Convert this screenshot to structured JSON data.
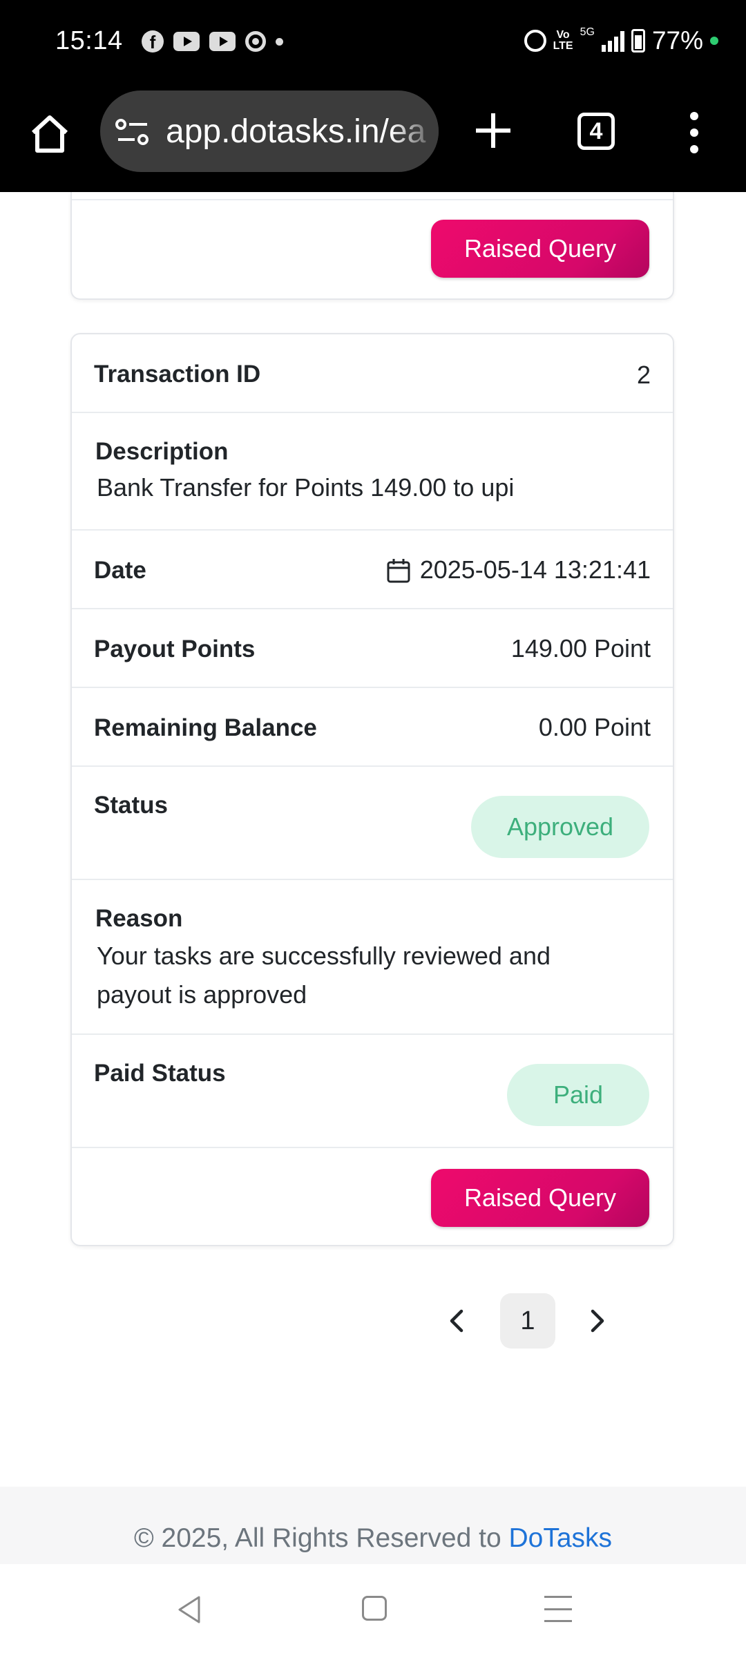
{
  "status_bar": {
    "time": "15:14",
    "battery": "77%",
    "volte": "Vo LTE",
    "network": "5G",
    "notification_icons": [
      "facebook-icon",
      "youtube-icon",
      "youtube-icon",
      "chrome-icon",
      "dot-icon"
    ]
  },
  "browser": {
    "url": "app.dotasks.in/ea",
    "tab_count": "4"
  },
  "previous_card": {
    "button_label": "Raised Query"
  },
  "transaction": {
    "id_label": "Transaction ID",
    "id_value": "2",
    "description_label": "Description",
    "description_value": "Bank Transfer for Points 149.00 to upi",
    "date_label": "Date",
    "date_value": "2025-05-14 13:21:41",
    "payout_label": "Payout Points",
    "payout_value": "149.00 Point",
    "balance_label": "Remaining Balance",
    "balance_value": "0.00 Point",
    "status_label": "Status",
    "status_value": "Approved",
    "reason_label": "Reason",
    "reason_value": "Your tasks are successfully reviewed and payout is approved",
    "paid_status_label": "Paid Status",
    "paid_status_value": "Paid",
    "button_label": "Raised Query"
  },
  "pagination": {
    "current_page": "1"
  },
  "footer": {
    "text": "© 2025, All Rights Reserved to ",
    "brand": "DoTasks"
  },
  "colors": {
    "accent": "#e8096c",
    "badge_bg": "#d9f5e8",
    "badge_text": "#3daf7c",
    "link": "#1e73d8"
  }
}
